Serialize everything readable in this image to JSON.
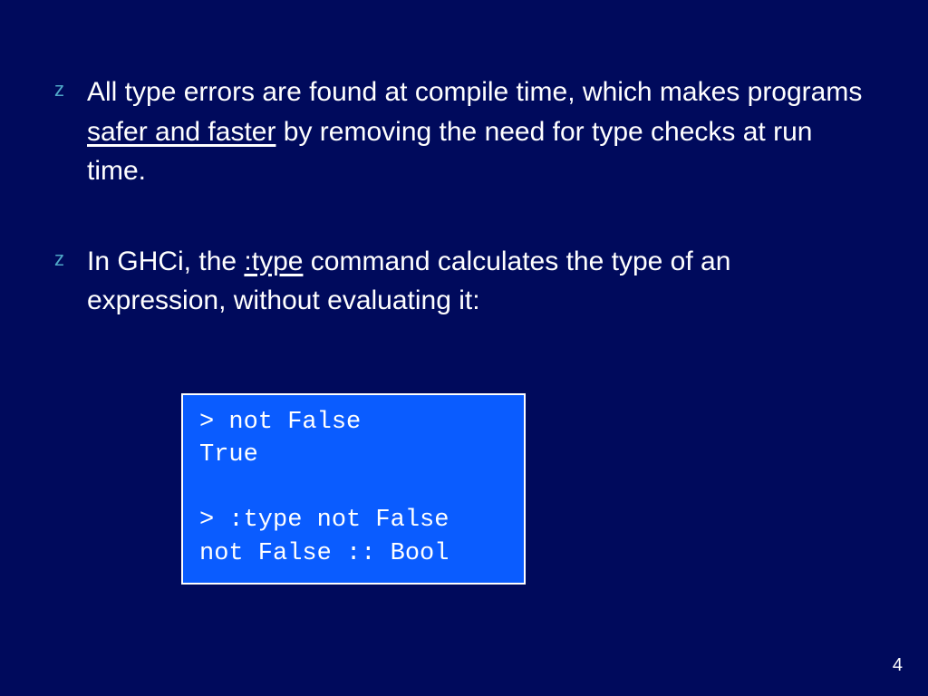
{
  "bullets": [
    {
      "marker": "z",
      "parts": [
        {
          "text": "All type errors are found at compile time, which makes programs ",
          "u": false
        },
        {
          "text": "safer and faster",
          "u": true
        },
        {
          "text": " by removing the need for type checks at run time.",
          "u": false
        }
      ]
    },
    {
      "marker": "z",
      "parts": [
        {
          "text": "In GHCi, the ",
          "u": false
        },
        {
          "text": ":type",
          "u": true
        },
        {
          "text": " command calculates the type of an expression, without evaluating it:",
          "u": false
        }
      ]
    }
  ],
  "code": {
    "lines": [
      "> not False",
      "True",
      "",
      "> :type not False",
      "not False :: Bool"
    ]
  },
  "page_number": "4"
}
